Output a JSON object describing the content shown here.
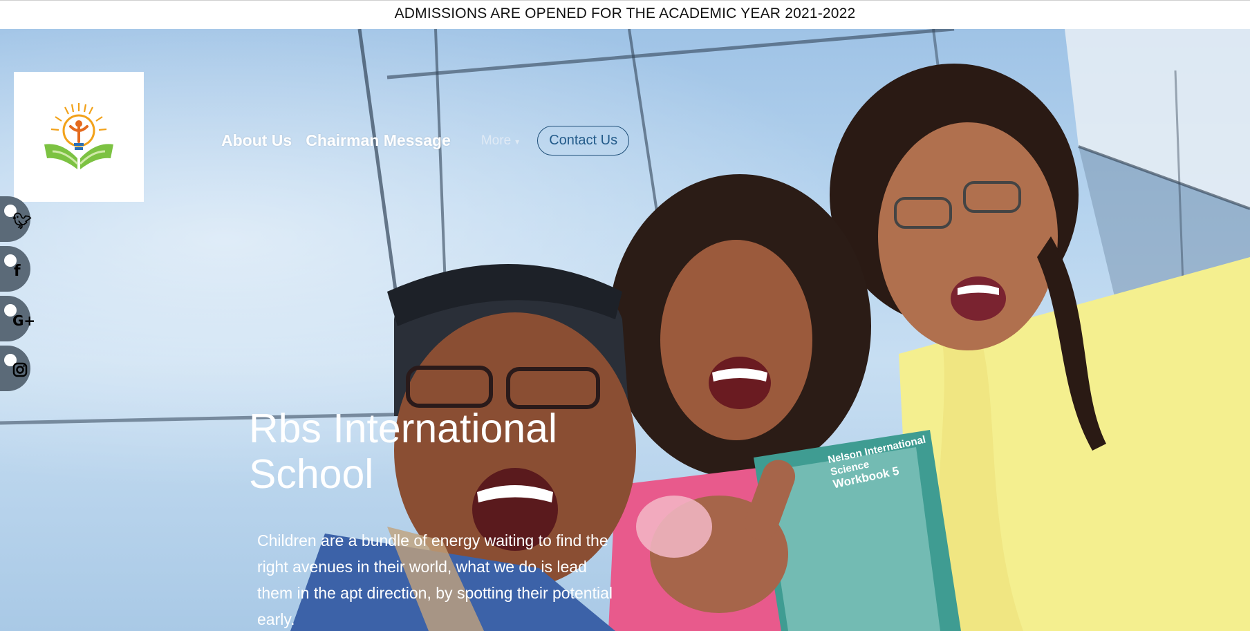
{
  "announcement": "ADMISSIONS ARE OPENED FOR THE ACADEMIC YEAR 2021-2022",
  "nav": {
    "links": [
      "About Us",
      "Chairman Message"
    ],
    "more_label": "More",
    "contact_label": "Contact Us"
  },
  "social": [
    {
      "icon": "twitter-icon",
      "glyph": "t"
    },
    {
      "icon": "facebook-icon",
      "glyph": "f"
    },
    {
      "icon": "google-plus-icon",
      "glyph": "G+"
    },
    {
      "icon": "instagram-icon",
      "glyph": "◘"
    }
  ],
  "hero": {
    "title": "Rbs International School",
    "description": "Children are a bundle of energy waiting to find the right avenues in their world, what we do is lead them in the apt direction, by spotting their potential early."
  },
  "book": {
    "line1": "Nelson International",
    "line2": "Science",
    "line3": "Workbook 5"
  },
  "colors": {
    "sky": "#b5d3ee",
    "logo_orange": "#f2a21b",
    "logo_green": "#7cc242",
    "contact_border": "#1f4f78"
  }
}
